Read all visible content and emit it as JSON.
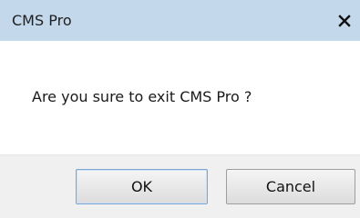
{
  "dialog": {
    "title": "CMS Pro",
    "close_icon": "close-icon",
    "message": "Are you sure to exit CMS Pro ?",
    "buttons": {
      "ok_label": "OK",
      "cancel_label": "Cancel"
    }
  },
  "colors": {
    "titlebar": "#c4d8ec",
    "content": "#ffffff",
    "footer": "#f0f0f0"
  }
}
